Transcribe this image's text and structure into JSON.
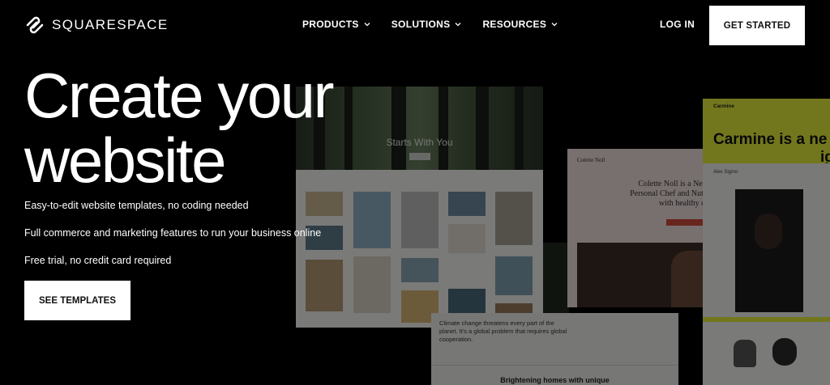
{
  "nav": {
    "brand": "SQUARESPACE",
    "items": [
      {
        "label": "PRODUCTS"
      },
      {
        "label": "SOLUTIONS"
      },
      {
        "label": "RESOURCES"
      }
    ],
    "login": "LOG IN",
    "get_started": "GET STARTED"
  },
  "hero": {
    "title_line1": "Create your",
    "title_line2": "website",
    "bullets": [
      "Easy-to-edit website templates, no coding needed",
      "Full commerce and marketing features to run your business online",
      "Free trial, no credit card required"
    ],
    "cta": "SEE TEMPLATES"
  },
  "collage": {
    "forest_title": "Starts With You",
    "chef_name": "Colette Noll",
    "chef_intro": "Colette Noll is a New Personal Chef and Nutri with healthy ca",
    "carmine_brand": "Carmine",
    "carmine_headline_1": "Carmine is a ne",
    "carmine_headline_2": "ig",
    "carmine_panel_name": "Alex Sigmo",
    "climate_text": "Climate change threatens every part of the planet. It's a global problem that requires global cooperation.",
    "climate_sub": "Brightening homes with unique"
  },
  "colors": {
    "background": "#000000",
    "button_bg": "#ffffff",
    "button_text": "#111111",
    "carmine_yellow": "#e4ef3b",
    "chef_pink": "#f1dede",
    "chef_accent": "#d14a3a"
  }
}
